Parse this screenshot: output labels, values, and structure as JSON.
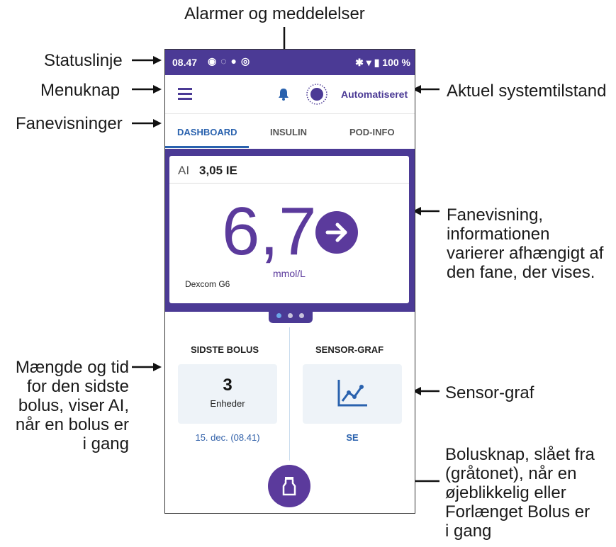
{
  "annotations": {
    "alarms": "Alarmer og meddelelser",
    "statusline": "Statuslinje",
    "menu": "Menuknap",
    "tabs": "Fanevisninger",
    "system_state": "Aktuel systemtilstand",
    "tab_view": [
      "Fanevisning,",
      "informationen",
      "varierer afhængigt af",
      "den fane, der vises."
    ],
    "last_bolus": [
      "Mængde og tid",
      "for den sidste",
      "bolus, viser AI,",
      "når en bolus er",
      "i gang"
    ],
    "sensor_graph": "Sensor-graf",
    "bolus_button": [
      "Bolusknap, slået fra",
      "(gråtonet), når en",
      "øjeblikkelig eller",
      "Forlænget Bolus er",
      "i gang"
    ]
  },
  "status_bar": {
    "time": "08.47",
    "battery": "100 %"
  },
  "header": {
    "mode": "Automatiseret"
  },
  "tabs": [
    "DASHBOARD",
    "INSULIN",
    "POD-INFO"
  ],
  "dashboard": {
    "iob_label": "AI",
    "iob_value": "3,05 IE",
    "glucose": "6,7",
    "unit": "mmol/L",
    "source": "Dexcom G6"
  },
  "last_bolus": {
    "title": "SIDSTE BOLUS",
    "amount": "3",
    "unit": "Enheder",
    "time": "15. dec. (08.41)"
  },
  "sensor_graph": {
    "title": "SENSOR-GRAF",
    "link": "SE"
  },
  "colors": {
    "brand": "#4b3a95",
    "accent": "#5b3a9c",
    "tab_active": "#2a62ae"
  }
}
